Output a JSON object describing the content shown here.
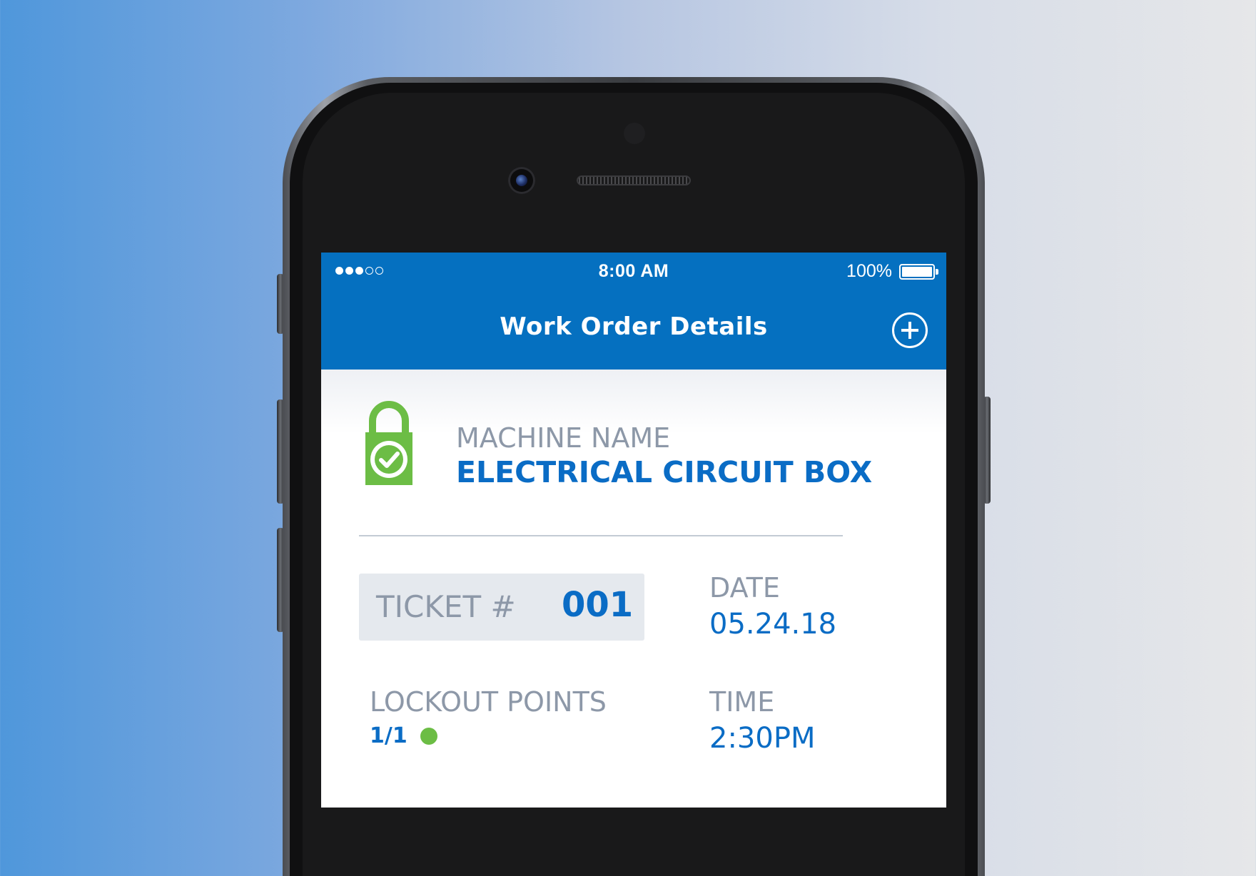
{
  "status_bar": {
    "signal_dots_total": 5,
    "signal_dots_filled": 3,
    "time": "8:00 AM",
    "battery_percent": "100%",
    "battery_level": 1.0
  },
  "header": {
    "title": "Work Order Details",
    "add_icon": "plus-circle-icon"
  },
  "machine": {
    "icon": "lock-check-icon",
    "label": "MACHINE NAME",
    "value": "ELECTRICAL CIRCUIT BOX"
  },
  "ticket": {
    "label": "TICKET #",
    "value": "001"
  },
  "date": {
    "label": "DATE",
    "value": "05.24.18"
  },
  "lockout": {
    "label": "LOCKOUT POINTS",
    "value": "1/1",
    "status_color": "#6cbd45"
  },
  "time": {
    "label": "TIME",
    "value": "2:30PM"
  },
  "colors": {
    "header_bg": "#0570c0",
    "accent_blue": "#0a6cc5",
    "label_gray": "#8d98a8",
    "lock_green": "#6cbd45",
    "ticket_bg": "#e5e9ee"
  }
}
